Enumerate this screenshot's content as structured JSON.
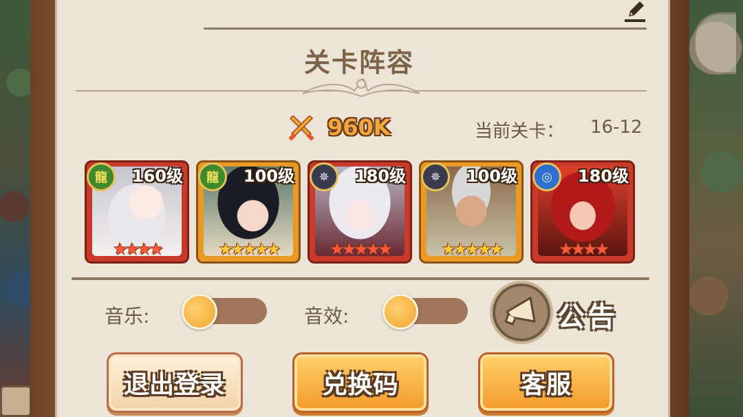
{
  "header": {
    "section_title": "关卡阵容",
    "edit_icon": "pencil-icon"
  },
  "stats": {
    "power_icon": "crossed-swords-icon",
    "power_value": "960K",
    "stage_label": "当前关卡：",
    "stage_value": "16-12"
  },
  "heroes": [
    {
      "level": "160级",
      "faction": "nature",
      "faction_icon": "dragon-emblem-icon",
      "frame": "red",
      "stars": 4
    },
    {
      "level": "100级",
      "faction": "nature",
      "faction_icon": "dragon-emblem-icon",
      "frame": "gold",
      "stars": 5
    },
    {
      "level": "180级",
      "faction": "dark",
      "faction_icon": "web-emblem-icon",
      "frame": "red",
      "stars": 5
    },
    {
      "level": "100级",
      "faction": "dark",
      "faction_icon": "web-emblem-icon",
      "frame": "gold",
      "stars": 5
    },
    {
      "level": "180级",
      "faction": "water",
      "faction_icon": "wave-emblem-icon",
      "frame": "red",
      "stars": 4
    }
  ],
  "settings": {
    "music_label": "音乐:",
    "sfx_label": "音效:",
    "music_on": false,
    "sfx_on": false,
    "notice_icon": "megaphone-icon",
    "notice_label": "公告"
  },
  "buttons": {
    "logout": "退出登录",
    "redeem": "兑换码",
    "support": "客服"
  },
  "colors": {
    "panel_bg": "#ece4d6",
    "frame_wood": "#8d5a35",
    "accent_orange": "#f29a2a",
    "text_brown": "#6b5a4a"
  }
}
